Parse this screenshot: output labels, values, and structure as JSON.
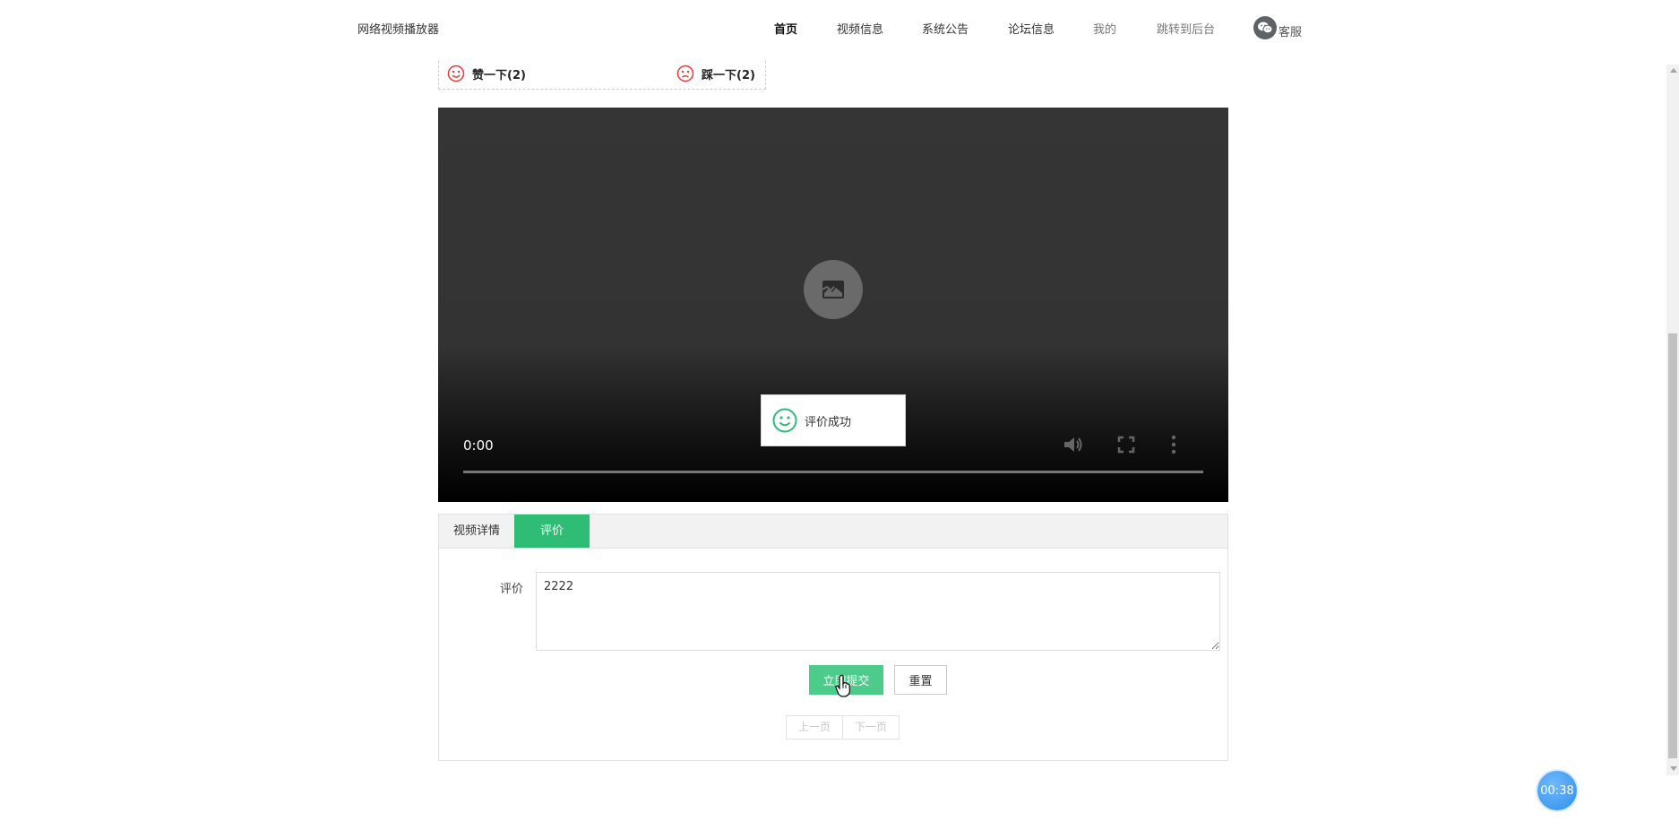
{
  "nav": {
    "brand": "网络视频播放器",
    "items": [
      "首页",
      "视频信息",
      "系统公告",
      "论坛信息",
      "我的",
      "跳转到后台"
    ],
    "customer_service": "客服"
  },
  "votes": {
    "like": "赞一下(2)",
    "dislike": "踩一下(2)"
  },
  "player": {
    "time": "0:00",
    "progress": 0
  },
  "toast": {
    "message": "评价成功"
  },
  "tabs": [
    "视频详情",
    "评价"
  ],
  "comment_form": {
    "label": "评价",
    "value": "2222",
    "submit": "立即提交",
    "reset": "重置"
  },
  "pager": {
    "prev": "上一页",
    "next": "下一页"
  },
  "timer": "00:38",
  "colors": {
    "accent": "#2fbd75",
    "submit": "#4ccb8a",
    "smile_red": "#e53935",
    "timer_blue": "#2f8fea"
  }
}
